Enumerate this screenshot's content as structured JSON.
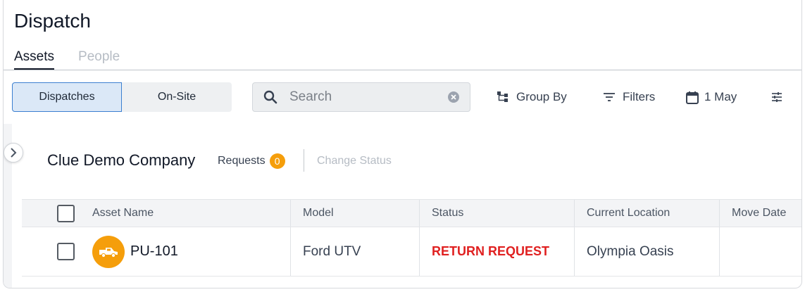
{
  "page": {
    "title": "Dispatch"
  },
  "tabs": [
    {
      "label": "Assets",
      "active": true
    },
    {
      "label": "People",
      "active": false
    }
  ],
  "view_toggle": {
    "active": "Dispatches",
    "inactive": "On-Site"
  },
  "search": {
    "placeholder": "Search",
    "value": ""
  },
  "toolbar": {
    "group_by": "Group By",
    "filters": "Filters",
    "date": "1 May"
  },
  "company": {
    "name": "Clue Demo Company",
    "requests_label": "Requests",
    "requests_count": "0",
    "change_status": "Change Status"
  },
  "table": {
    "columns": [
      "Asset Name",
      "Model",
      "Status",
      "Current Location",
      "Move Date"
    ],
    "rows": [
      {
        "asset": "PU-101",
        "model": "Ford UTV",
        "status": "RETURN REQUEST",
        "location": "Olympia Oasis",
        "move_date": ""
      }
    ]
  },
  "colors": {
    "accent": "#3b7fd0",
    "badge": "#f59e0b",
    "status_return": "#e02020"
  },
  "icons": [
    "search-icon",
    "clear-icon",
    "group-by-icon",
    "filter-icon",
    "calendar-icon",
    "settings-sliders-icon",
    "chevron-right-icon",
    "pickup-truck-icon"
  ]
}
